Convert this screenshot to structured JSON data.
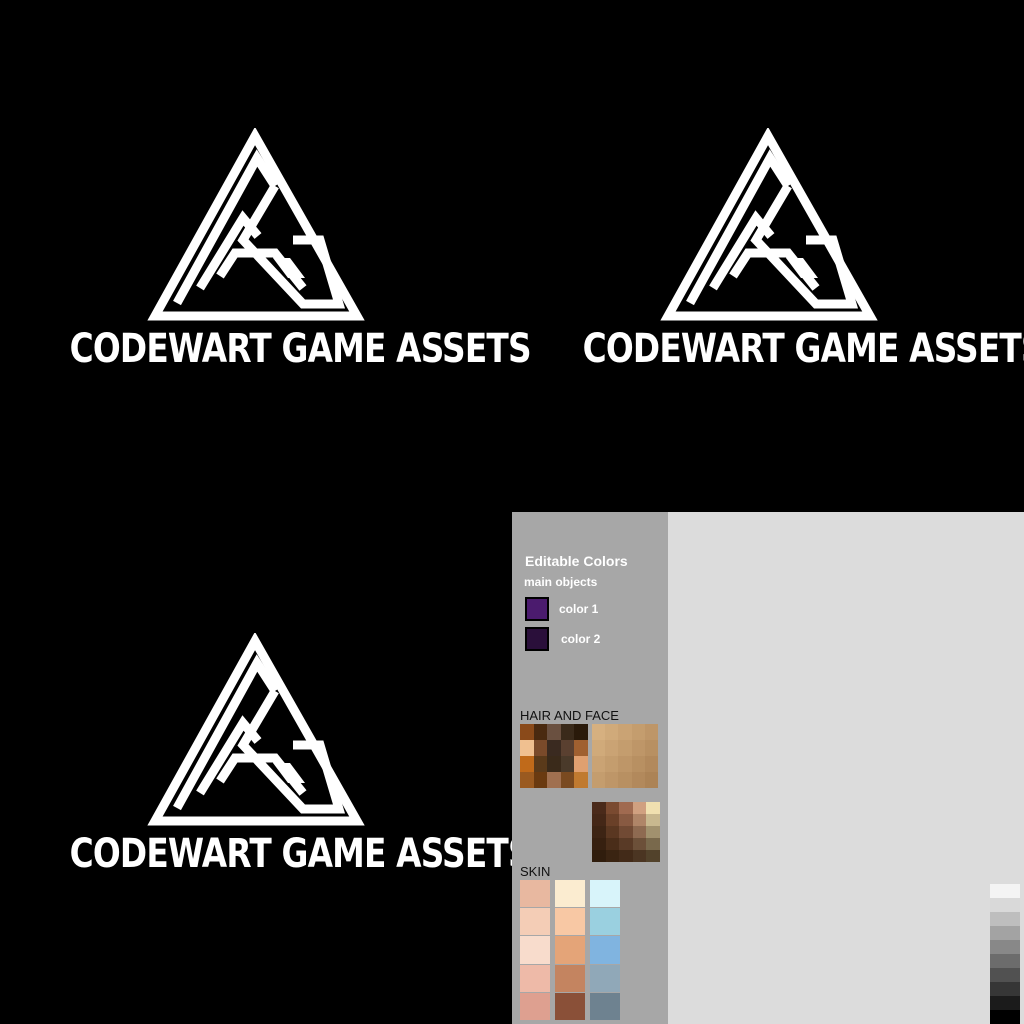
{
  "logos": [
    {
      "name": "CODEWART GAME ASSETS"
    },
    {
      "name": "CODEWART GAME ASSETS"
    },
    {
      "name": "CODEWART GAME ASSETS"
    }
  ],
  "palette": {
    "heading": "Editable Colors",
    "subheading": "main objects",
    "color1": {
      "label": "color 1",
      "hex": "#4b1b6e"
    },
    "color2": {
      "label": "color 2",
      "hex": "#2a0f3a"
    },
    "hair_and_face_label": "HAIR AND FACE",
    "skin_label": "SKIN"
  }
}
